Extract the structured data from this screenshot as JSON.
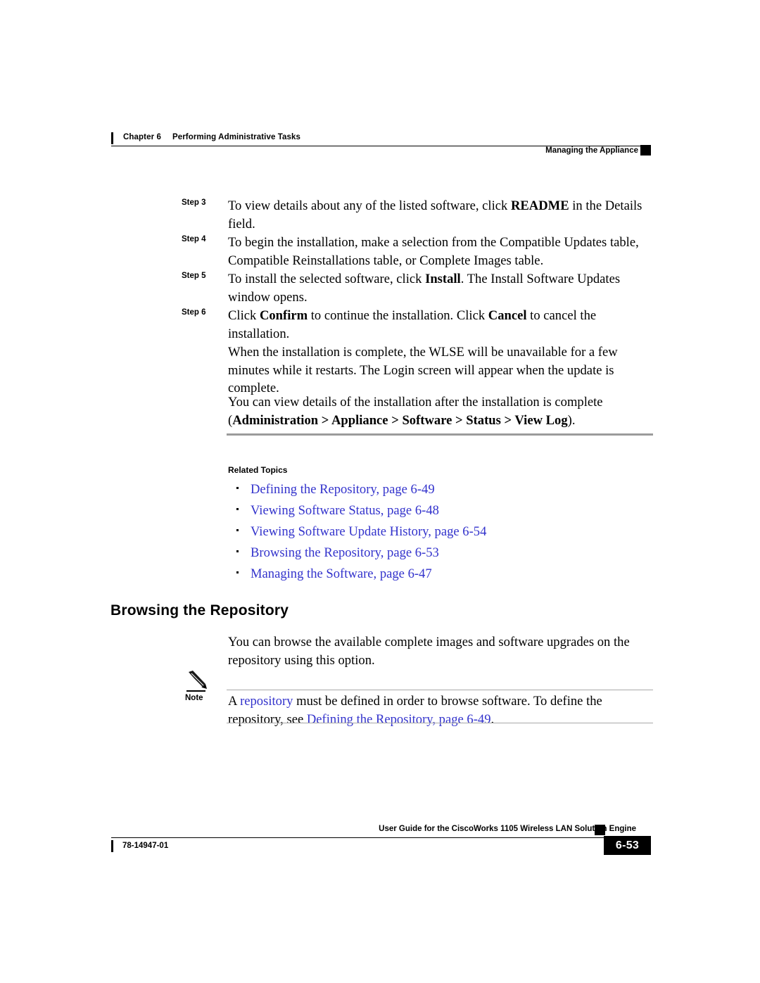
{
  "header": {
    "chapter_number": "Chapter 6",
    "chapter_title": "Performing Administrative Tasks",
    "running_head_right": "Managing the Appliance"
  },
  "steps": [
    {
      "label": "Step 3",
      "segments": [
        {
          "text": "To view details about any of the listed software, click ",
          "bold": false
        },
        {
          "text": "README",
          "bold": true
        },
        {
          "text": " in the Details field.",
          "bold": false
        }
      ]
    },
    {
      "label": "Step 4",
      "segments": [
        {
          "text": "To begin the installation, make a selection from the Compatible Updates table, Compatible Reinstallations table, or Complete Images table.",
          "bold": false
        }
      ]
    },
    {
      "label": "Step 5",
      "segments": [
        {
          "text": "To install the selected software, click ",
          "bold": false
        },
        {
          "text": "Install",
          "bold": true
        },
        {
          "text": ". The Install Software Updates window opens.",
          "bold": false
        }
      ]
    },
    {
      "label": "Step 6",
      "segments": [
        {
          "text": "Click ",
          "bold": false
        },
        {
          "text": "Confirm",
          "bold": true
        },
        {
          "text": " to continue the installation. Click ",
          "bold": false
        },
        {
          "text": "Cancel",
          "bold": true
        },
        {
          "text": " to cancel the installation.",
          "bold": false
        }
      ]
    }
  ],
  "paragraphs": [
    {
      "segments": [
        {
          "text": "When the installation is complete, the WLSE will be unavailable for a few minutes while it restarts. The Login screen will appear when the update is complete.",
          "bold": false
        }
      ]
    },
    {
      "segments": [
        {
          "text": "You can view details of the installation after the installation is complete (",
          "bold": false
        },
        {
          "text": "Administration > Appliance > Software > Status > View Log",
          "bold": true
        },
        {
          "text": ").",
          "bold": false
        }
      ]
    }
  ],
  "related_topics": {
    "heading": "Related Topics",
    "items": [
      "Defining the Repository, page 6-49",
      "Viewing Software Status, page 6-48",
      "Viewing Software Update History, page 6-54",
      "Browsing the Repository, page 6-53",
      "Managing the Software, page 6-47"
    ]
  },
  "section": {
    "heading": "Browsing the Repository",
    "intro": "You can browse the available complete images and software upgrades on the repository using this option."
  },
  "note": {
    "label": "Note",
    "icon": "pencil-icon",
    "segments": [
      {
        "text": "A ",
        "link": false
      },
      {
        "text": "repository",
        "link": true
      },
      {
        "text": " must be defined in order to browse software. To define the repository, see ",
        "link": false
      },
      {
        "text": "Defining the Repository, page 6-49",
        "link": true
      },
      {
        "text": ".",
        "link": false
      }
    ]
  },
  "footer": {
    "title": "User Guide for the CiscoWorks 1105 Wireless LAN Solution Engine",
    "doc_number": "78-14947-01",
    "page_number": "6-53"
  },
  "colors": {
    "link": "#3333cc",
    "rule_gray": "#9b9b9b",
    "text": "#000000"
  }
}
